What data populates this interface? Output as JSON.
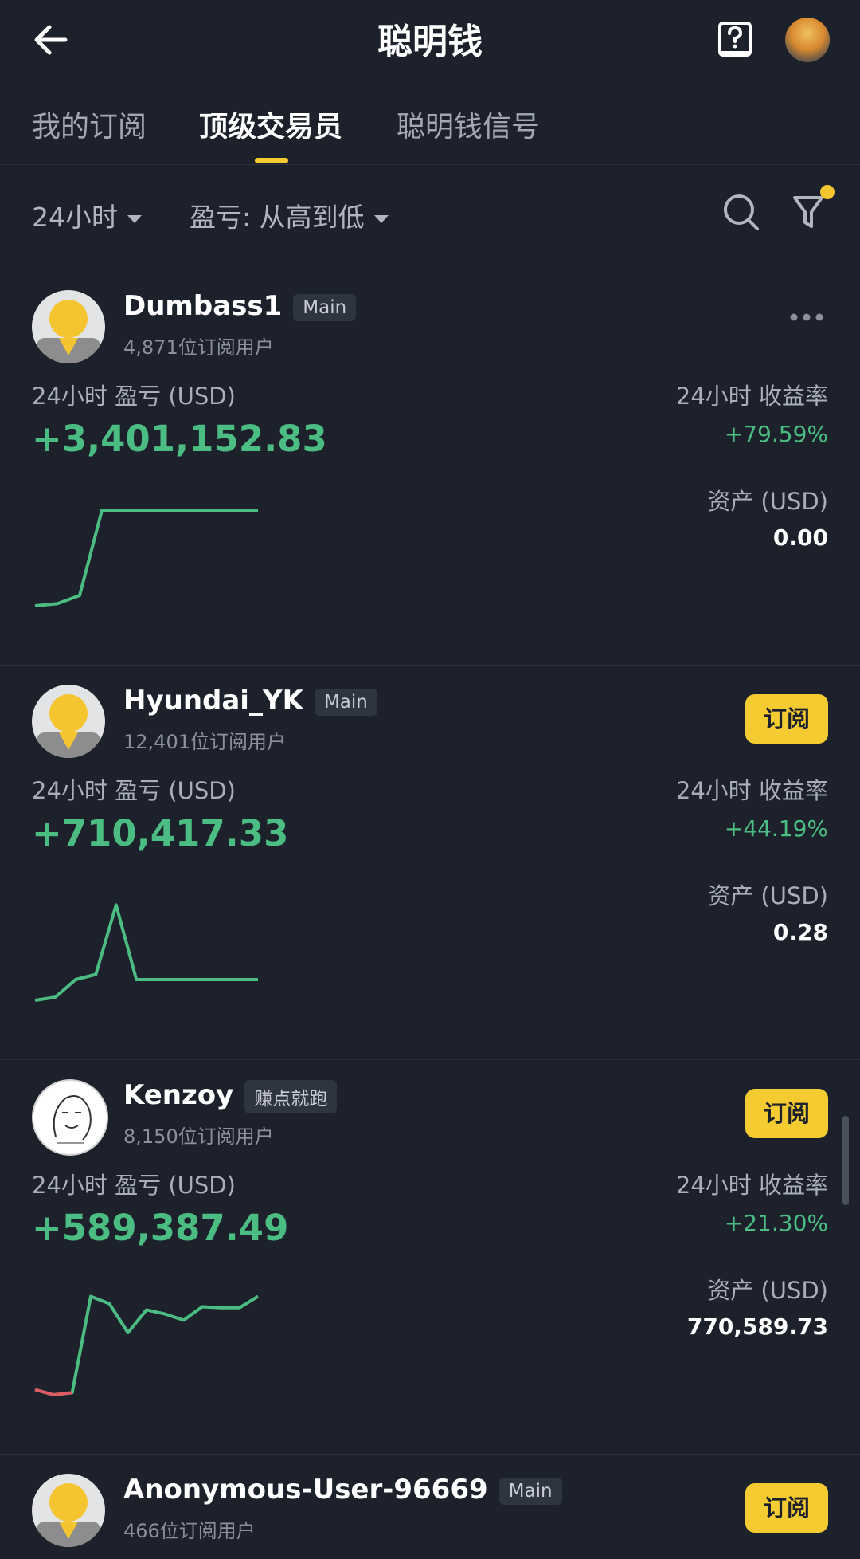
{
  "header": {
    "title": "聪明钱",
    "back_icon": "arrow-left-icon",
    "help_icon": "question-book-icon"
  },
  "tabs": [
    {
      "label": "我的订阅",
      "active": false
    },
    {
      "label": "顶级交易员",
      "active": true
    },
    {
      "label": "聪明钱信号",
      "active": false
    }
  ],
  "filters": {
    "period": "24小时",
    "sort": "盈亏: 从高到低"
  },
  "colors": {
    "accent": "#f5cb32",
    "positive": "#4cbd82",
    "negative": "#e05a63",
    "background": "#1c212b"
  },
  "traders": [
    {
      "name": "Dumbass1",
      "badge": "Main",
      "subscribers": "4,871位订阅用户",
      "pnl_label": "24小时 盈亏 (USD)",
      "pnl": "+3,401,152.83",
      "roi_label": "24小时 收益率",
      "roi": "+79.59%",
      "assets_label": "资产 (USD)",
      "assets": "0.00",
      "action": "more",
      "spark_trend": [
        0.0,
        0.02,
        0.1,
        0.92,
        0.92,
        0.92,
        0.92,
        0.92,
        0.92,
        0.92,
        0.92
      ]
    },
    {
      "name": "Hyundai_YK",
      "badge": "Main",
      "subscribers": "12,401位订阅用户",
      "pnl_label": "24小时 盈亏 (USD)",
      "pnl": "+710,417.33",
      "roi_label": "24小时 收益率",
      "roi": "+44.19%",
      "assets_label": "资产 (USD)",
      "assets": "0.28",
      "action_label": "订阅",
      "spark_trend": [
        0.0,
        0.03,
        0.2,
        0.25,
        0.92,
        0.2,
        0.2,
        0.2,
        0.2,
        0.2,
        0.2,
        0.2
      ]
    },
    {
      "name": "Kenzoy",
      "badge": "赚点就跑",
      "subscribers": "8,150位订阅用户",
      "pnl_label": "24小时 盈亏 (USD)",
      "pnl": "+589,387.49",
      "roi_label": "24小时 收益率",
      "roi": "+21.30%",
      "assets_label": "资产 (USD)",
      "assets": "770,589.73",
      "action_label": "订阅",
      "spark_trend": [
        0.05,
        0.0,
        0.02,
        0.95,
        0.88,
        0.6,
        0.82,
        0.78,
        0.72,
        0.85,
        0.84,
        0.84,
        0.95
      ]
    },
    {
      "name": "Anonymous-User-96669",
      "badge": "Main",
      "subscribers": "466位订阅用户",
      "action_label": "订阅"
    }
  ]
}
